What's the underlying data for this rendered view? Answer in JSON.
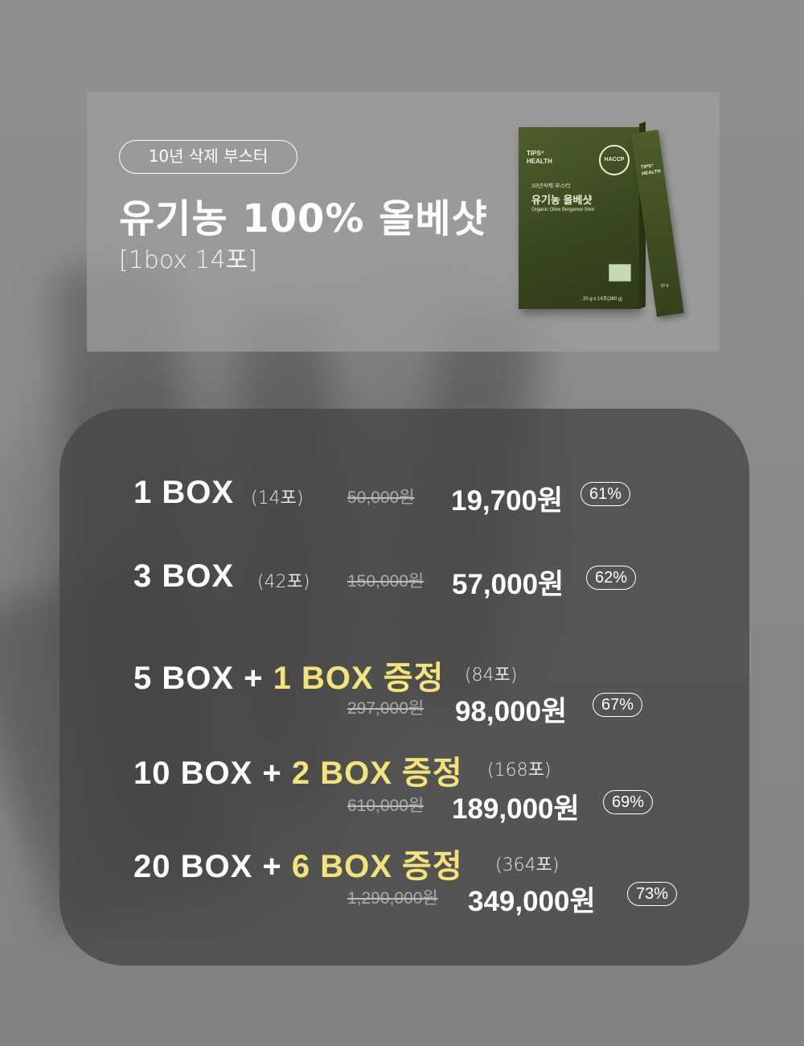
{
  "hero": {
    "tag": "10년 삭제 부스터",
    "title": "유기농 100% 올베샷",
    "subtitle": "[1box 14포]"
  },
  "product": {
    "brand": "TIPS⁺ HEALTH",
    "seal": "HACCP",
    "box_small": "10년삭제 부스터",
    "box_name": "유기농 올베샷",
    "box_en": "Organic Olive Bergamot Shot",
    "box_weight": "20 g x 14포(280 g)",
    "stick_brand": "TIPS⁺ HEALTH",
    "stick_weight": "20 g"
  },
  "offers": [
    {
      "label": "1 BOX",
      "gift": "",
      "count": "(14포)",
      "original": "50,000원",
      "price": "19,700원",
      "discount": "61%"
    },
    {
      "label": "3 BOX",
      "gift": "",
      "count": "(42포)",
      "original": "150,000원",
      "price": "57,000원",
      "discount": "62%"
    },
    {
      "label": "5 BOX + ",
      "gift": "1 BOX 증정",
      "count": "(84포)",
      "original": "297,000원",
      "price": "98,000원",
      "discount": "67%"
    },
    {
      "label": "10 BOX + ",
      "gift": "2 BOX 증정",
      "count": "(168포)",
      "original": "610,000원",
      "price": "189,000원",
      "discount": "69%"
    },
    {
      "label": "20 BOX + ",
      "gift": "6 BOX 증정",
      "count": "(364포)",
      "original": "1,290,000원",
      "price": "349,000원",
      "discount": "73%"
    }
  ]
}
